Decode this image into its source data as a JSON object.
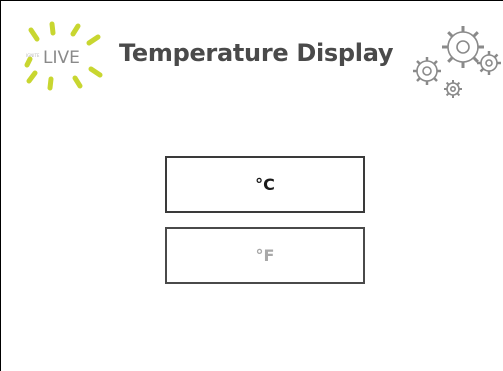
{
  "header": {
    "logo_text": "LIVE",
    "logo_small_text": "IGNITE",
    "title": "Temperature Display"
  },
  "units": {
    "celsius_label": "°C",
    "fahrenheit_label": "°F",
    "selected": "celsius"
  },
  "colors": {
    "logo_accent": "#c8d630",
    "title": "#4a4a4a",
    "selected_text": "#1a1a1a",
    "unselected_text": "#a8a8a8"
  },
  "icons": {
    "logo": "live-logo-icon",
    "gears": "gears-icon"
  }
}
